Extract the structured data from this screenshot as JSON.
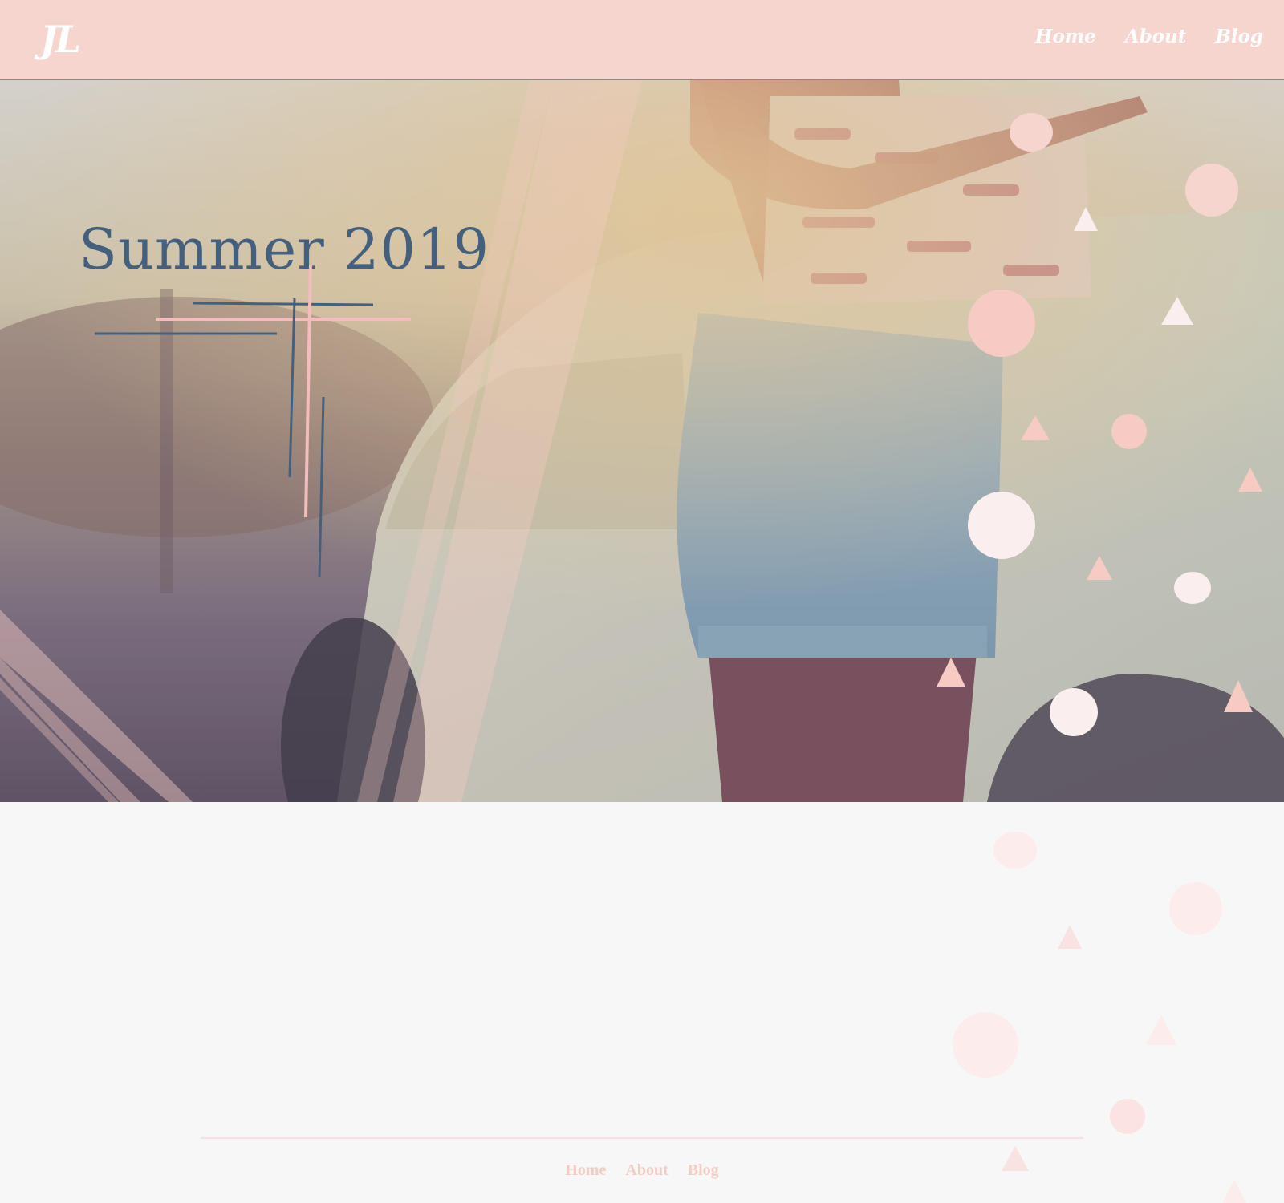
{
  "header": {
    "logo": "JL",
    "nav": [
      {
        "label": "Home"
      },
      {
        "label": "About"
      },
      {
        "label": "Blog"
      }
    ]
  },
  "hero": {
    "title": "Summer 2019"
  },
  "footer": {
    "nav": [
      {
        "label": "Home"
      },
      {
        "label": "About"
      },
      {
        "label": "Blog"
      }
    ]
  },
  "colors": {
    "header_bg": "#f6d5cf",
    "title": "#44607f",
    "accent_pink": "#f5cbc3",
    "footer_link": "#f2cdc6",
    "page_bg": "#f7f7f7"
  }
}
